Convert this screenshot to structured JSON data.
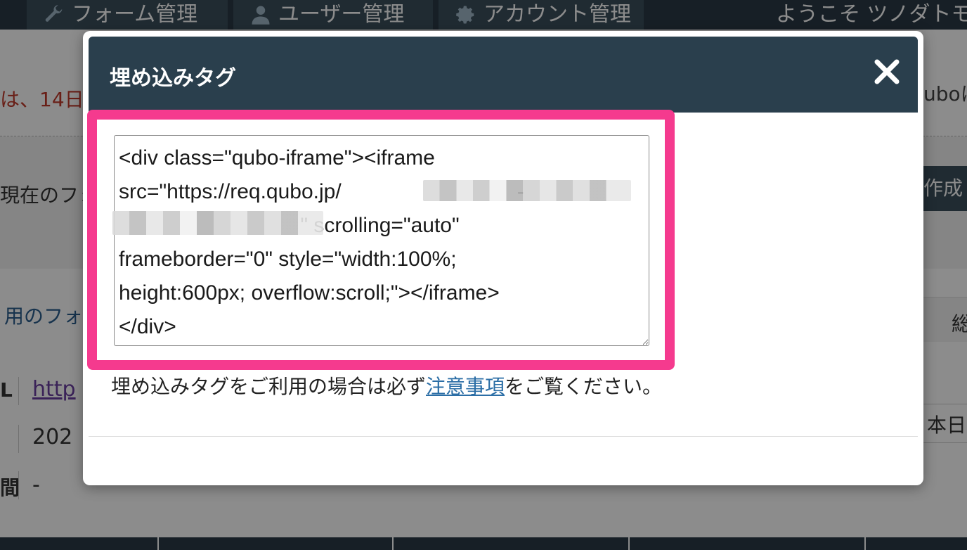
{
  "nav": {
    "tabs": [
      {
        "label": "フォーム管理",
        "icon": "wrench-icon"
      },
      {
        "label": "ユーザー管理",
        "icon": "user-icon"
      },
      {
        "label": "アカウント管理",
        "icon": "gear-icon"
      }
    ],
    "welcome": "ようこそ ツノダトモ"
  },
  "background": {
    "trial_text": "は、14日",
    "trial_text_right": "uboに",
    "current_label": "現在のフォ",
    "create_button": "作成",
    "form_row_label": "用のフォ",
    "right_col_label": "総",
    "info_rows": [
      {
        "label": "L",
        "value": "http"
      },
      {
        "label": "",
        "value": "202"
      },
      {
        "label": "間",
        "value": "-"
      }
    ],
    "today_label": "本日"
  },
  "modal": {
    "title": "埋め込みタグ",
    "close_label": "✕",
    "embed_code": "<div class=\"qubo-iframe\"><iframe\nsrc=\"https://req.qubo.jp/                              -\n                               \" scrolling=\"auto\"\nframeborder=\"0\" style=\"width:100%;\nheight:600px; overflow:scroll;\"></iframe>\n</div>",
    "notice_prefix": "埋め込みタグをご利用の場合は必ず",
    "notice_link": "注意事項",
    "notice_suffix": "をご覧ください。"
  },
  "colors": {
    "header_bg": "#2a3f4d",
    "highlight": "#f53a8e",
    "link": "#2b6ea6"
  }
}
